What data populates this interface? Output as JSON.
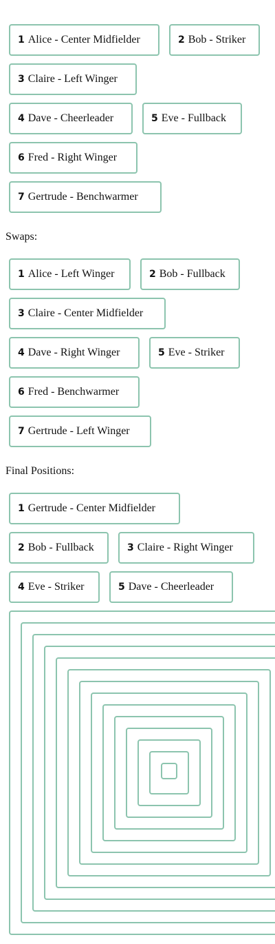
{
  "initial_positions": [
    {
      "num": "1",
      "text": "Alice - Center Midfielder"
    },
    {
      "num": "2",
      "text": "Bob - Striker"
    },
    {
      "num": "3",
      "text": "Claire - Left Winger"
    },
    {
      "num": "4",
      "text": "Dave - Cheerleader"
    },
    {
      "num": "5",
      "text": "Eve - Fullback"
    },
    {
      "num": "6",
      "text": "Fred - Right Winger"
    },
    {
      "num": "7",
      "text": "Gertrude - Benchwarmer"
    }
  ],
  "swaps_label": "Swaps:",
  "swaps": [
    {
      "num": "1",
      "text": "Alice - Left Winger"
    },
    {
      "num": "2",
      "text": "Bob - Fullback"
    },
    {
      "num": "3",
      "text": "Claire - Center Midfielder"
    },
    {
      "num": "4",
      "text": "Dave - Right Winger"
    },
    {
      "num": "5",
      "text": "Eve - Striker"
    },
    {
      "num": "6",
      "text": "Fred - Benchwarmer"
    },
    {
      "num": "7",
      "text": "Gertrude - Left Winger"
    }
  ],
  "final_label": "Final Positions:",
  "final_positions": [
    {
      "num": "1",
      "text": "Gertrude - Center Midfielder"
    },
    {
      "num": "2",
      "text": "Bob - Fullback"
    },
    {
      "num": "3",
      "text": "Claire - Right Winger"
    },
    {
      "num": "4",
      "text": "Eve - Striker"
    },
    {
      "num": "5",
      "text": "Dave - Cheerleader"
    }
  ]
}
